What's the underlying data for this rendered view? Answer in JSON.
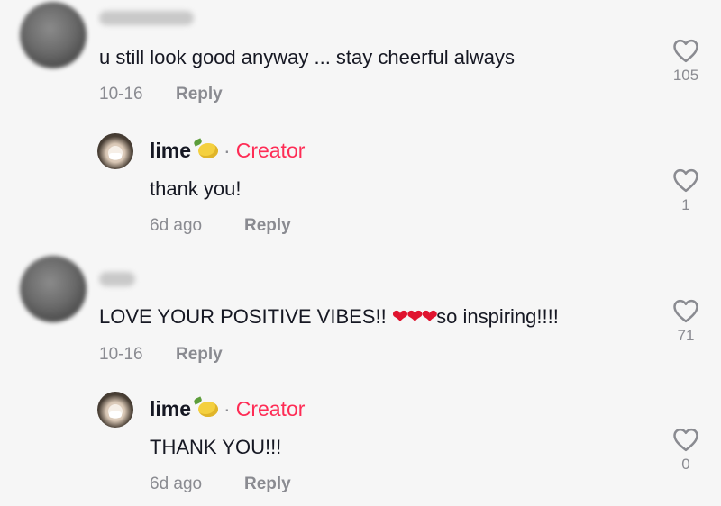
{
  "comments": [
    {
      "text": "u still look good anyway ... stay cheerful always",
      "date": "10-16",
      "reply_label": "Reply",
      "likes": "105",
      "reply": {
        "author": "lime",
        "role": "Creator",
        "text": "thank you!",
        "date": "6d ago",
        "reply_label": "Reply",
        "likes": "1"
      }
    },
    {
      "text_before": "LOVE YOUR POSITIVE VIBES!! ",
      "hearts": "❤❤❤",
      "text_after": "so inspiring!!!!",
      "date": "10-16",
      "reply_label": "Reply",
      "likes": "71",
      "reply": {
        "author": "lime",
        "role": "Creator",
        "text": "THANK YOU!!!",
        "date": "6d ago",
        "reply_label": "Reply",
        "likes": "0"
      }
    }
  ]
}
